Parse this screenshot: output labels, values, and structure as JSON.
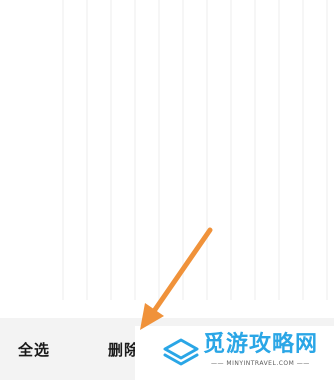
{
  "toolbar": {
    "select_all_label": "全选",
    "delete_label": "删除"
  },
  "watermark": {
    "title": "觅游攻略网",
    "subtitle": "—— MINYINTRAVEL.COM ——",
    "color": "#2aa6e6"
  },
  "annotation": {
    "arrow_color": "#f0923a",
    "icon": "arrow-pointer-icon"
  }
}
